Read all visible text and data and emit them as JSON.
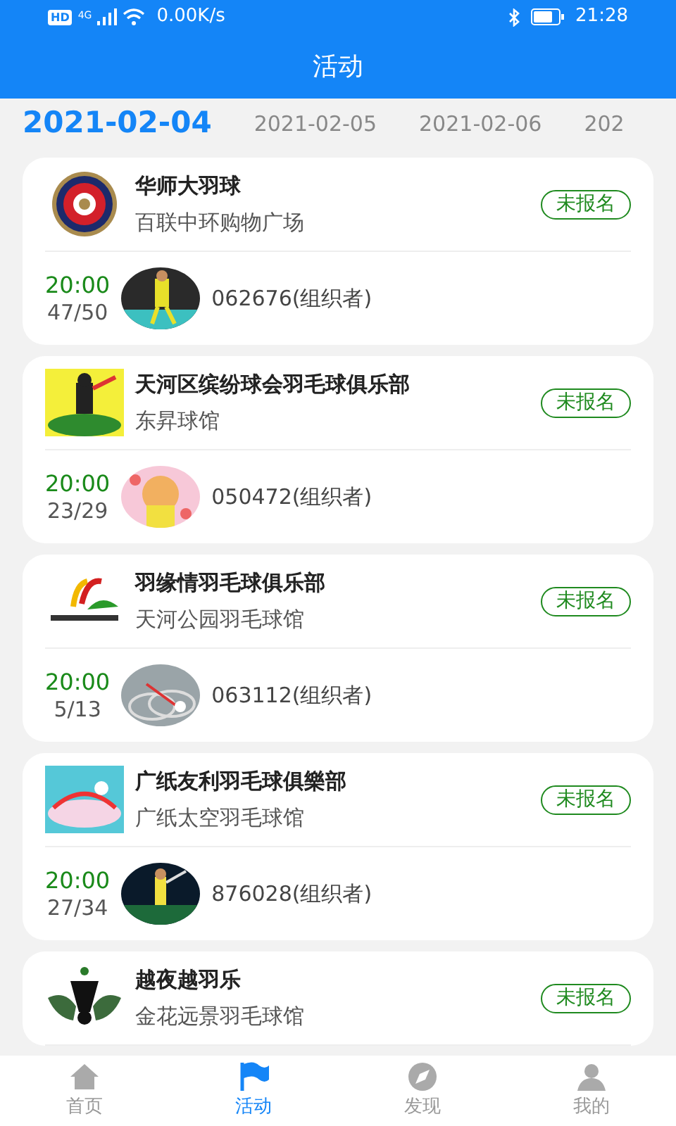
{
  "status_bar": {
    "network_badge": "HD",
    "network_type": "4G",
    "speed": "0.00K/s",
    "time": "21:28"
  },
  "header": {
    "title": "活动"
  },
  "date_tabs": [
    {
      "label": "2021-02-04",
      "selected": true
    },
    {
      "label": "2021-02-05",
      "selected": false
    },
    {
      "label": "2021-02-06",
      "selected": false
    },
    {
      "label": "202",
      "selected": false
    }
  ],
  "activities": [
    {
      "club": "华师大羽球",
      "venue": "百联中环购物广场",
      "registration": "未报名",
      "time": "20:00",
      "count": "47/50",
      "organizer": "062676(组织者)"
    },
    {
      "club": "天河区缤纷球会羽毛球俱乐部",
      "venue": "东昇球馆",
      "registration": "未报名",
      "time": "20:00",
      "count": "23/29",
      "organizer": "050472(组织者)"
    },
    {
      "club": "羽缘情羽毛球俱乐部",
      "venue": "天河公园羽毛球馆",
      "registration": "未报名",
      "time": "20:00",
      "count": "5/13",
      "organizer": "063112(组织者)"
    },
    {
      "club": "广纸友利羽毛球俱樂部",
      "venue": "广纸太空羽毛球馆",
      "registration": "未报名",
      "time": "20:00",
      "count": "27/34",
      "organizer": "876028(组织者)"
    },
    {
      "club": "越夜越羽乐",
      "venue": "金花远景羽毛球馆",
      "registration": "未报名"
    }
  ],
  "bottom_nav": [
    {
      "label": "首页",
      "selected": false
    },
    {
      "label": "活动",
      "selected": true
    },
    {
      "label": "发现",
      "selected": false
    },
    {
      "label": "我的",
      "selected": false
    }
  ]
}
